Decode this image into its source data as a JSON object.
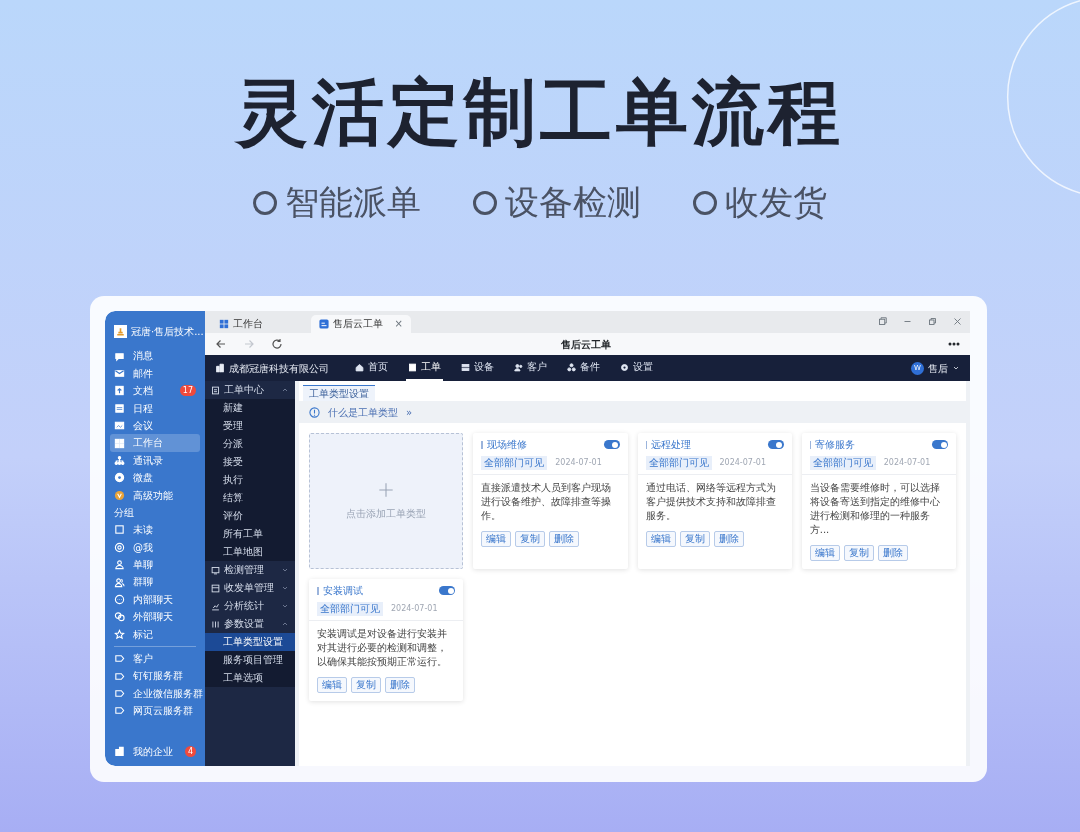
{
  "headline": "灵活定制工单流程",
  "features": [
    "智能派单",
    "设备检测",
    "收发货"
  ],
  "app": {
    "org_name": "冠唐·售后技术...",
    "sidebar_sections": [
      {
        "items": [
          {
            "label": "消息",
            "selected": false
          },
          {
            "label": "邮件",
            "selected": false
          },
          {
            "label": "文档",
            "selected": false,
            "badge": "17"
          },
          {
            "label": "日程",
            "selected": false
          },
          {
            "label": "会议",
            "selected": false
          },
          {
            "label": "工作台",
            "selected": true
          },
          {
            "label": "通讯录",
            "selected": false
          },
          {
            "label": "微盘",
            "selected": false
          },
          {
            "label": "高级功能",
            "selected": false
          }
        ]
      },
      {
        "heading": "分组",
        "items": [
          {
            "label": "未读",
            "selected": false
          },
          {
            "label": "@我",
            "selected": false
          },
          {
            "label": "单聊",
            "selected": false
          },
          {
            "label": "群聊",
            "selected": false
          },
          {
            "label": "内部聊天",
            "selected": false
          },
          {
            "label": "外部聊天",
            "selected": false
          },
          {
            "label": "标记",
            "selected": false
          }
        ]
      },
      {
        "items": [
          {
            "label": "客户",
            "selected": false
          },
          {
            "label": "钉钉服务群",
            "selected": false
          },
          {
            "label": "企业微信服务群",
            "selected": false
          },
          {
            "label": "网页云服务群",
            "selected": false
          }
        ]
      }
    ],
    "sidebar_footer": {
      "label": "我的企业",
      "badge": "4"
    },
    "browser_tabs": [
      {
        "label": "工作台",
        "selected": false
      },
      {
        "label": "售后云工单",
        "selected": true,
        "close": "×"
      }
    ],
    "nav_buttons": [
      {
        "kind": "back",
        "disabled": false
      },
      {
        "kind": "forward",
        "disabled": true
      },
      {
        "kind": "reload",
        "disabled": false
      }
    ],
    "page_title": "售后云工单",
    "company": "成都冠唐科技有限公司",
    "top_nav": [
      {
        "label": "首页",
        "selected": false
      },
      {
        "label": "工单",
        "selected": true
      },
      {
        "label": "设备",
        "selected": false
      },
      {
        "label": "客户",
        "selected": false
      },
      {
        "label": "备件",
        "selected": false
      },
      {
        "label": "设置",
        "selected": false
      }
    ],
    "user": {
      "avatar": "W",
      "name": "售后"
    },
    "menu": [
      {
        "label": "工单中心",
        "expanded": true,
        "children": [
          {
            "label": "新建",
            "selected": false
          },
          {
            "label": "受理",
            "selected": false
          },
          {
            "label": "分派",
            "selected": false
          },
          {
            "label": "接受",
            "selected": false
          },
          {
            "label": "执行",
            "selected": false
          },
          {
            "label": "结算",
            "selected": false
          },
          {
            "label": "评价",
            "selected": false
          },
          {
            "label": "所有工单",
            "selected": false
          },
          {
            "label": "工单地图",
            "selected": false
          }
        ]
      },
      {
        "label": "检测管理",
        "expanded": false
      },
      {
        "label": "收发单管理",
        "expanded": false
      },
      {
        "label": "分析统计",
        "expanded": false
      },
      {
        "label": "参数设置",
        "expanded": true,
        "children": [
          {
            "label": "工单类型设置",
            "selected": true
          },
          {
            "label": "服务项目管理",
            "selected": false
          },
          {
            "label": "工单选项",
            "selected": false
          }
        ]
      }
    ],
    "page_tabs": [
      {
        "label": "工单类型设置",
        "selected": true
      }
    ],
    "info_link": {
      "label": "什么是工单类型",
      "arrow": "»"
    },
    "add_card": {
      "label": "点击添加工单类型"
    },
    "cards": [
      {
        "name": "现场维修",
        "on": true,
        "scope": "全部部门可见",
        "date": "2024-07-01",
        "description": "直接派遣技术人员到客户现场进行设备维护、故障排查等操作。",
        "buttons": [
          "编辑",
          "复制",
          "删除"
        ]
      },
      {
        "name": "远程处理",
        "on": true,
        "scope": "全部部门可见",
        "date": "2024-07-01",
        "description": "通过电话、网络等远程方式为客户提供技术支持和故障排查服务。",
        "buttons": [
          "编辑",
          "复制",
          "删除"
        ]
      },
      {
        "name": "寄修服务",
        "on": true,
        "scope": "全部部门可见",
        "date": "2024-07-01",
        "description": "当设备需要维修时，可以选择将设备寄送到指定的维修中心进行检测和修理的一种服务方...",
        "buttons": [
          "编辑",
          "复制",
          "删除"
        ]
      },
      {
        "name": "安装调试",
        "on": true,
        "scope": "全部部门可见",
        "date": "2024-07-01",
        "description": "安装调试是对设备进行安装并对其进行必要的检测和调整，以确保其能按预期正常运行。",
        "buttons": [
          "编辑",
          "复制",
          "删除"
        ]
      }
    ]
  }
}
